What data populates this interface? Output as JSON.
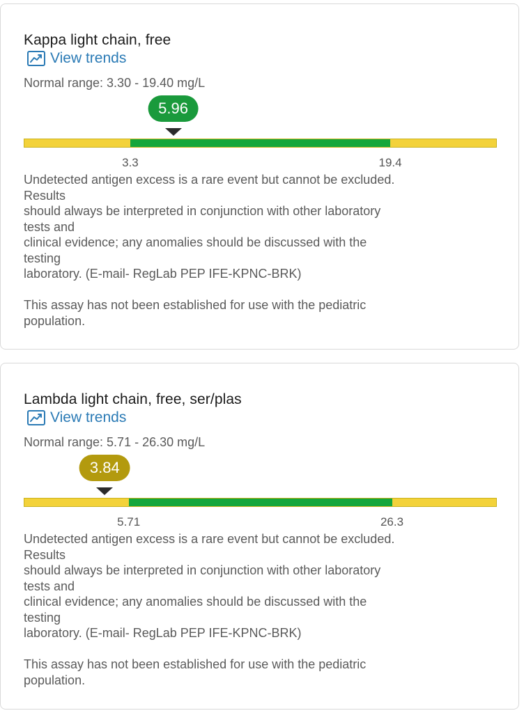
{
  "results": [
    {
      "title": "Kappa light chain, free",
      "trends_label": "View trends",
      "trends_icon": "trend-chart-icon",
      "normal_range": "Normal range: 3.30 - 19.40 mg/L",
      "value": "5.96",
      "value_color": "#1a9a3c",
      "low_label": "3.3",
      "high_label": "19.4",
      "scale": {
        "min": -3.3,
        "low": 3.3,
        "high": 19.4,
        "max": 26.0
      },
      "colors": {
        "out_of_range": "#f3d23a",
        "in_range": "#14a63c"
      },
      "comment_lines": [
        "Undetected antigen excess is a rare event but cannot be excluded.",
        "Results",
        "should always be interpreted in conjunction with other laboratory",
        "tests and",
        "clinical evidence; any anomalies should be discussed with the",
        "testing",
        "laboratory. (E-mail- RegLab PEP IFE-KPNC-BRK)"
      ],
      "pediatric_lines": [
        "This assay has not been established for use with the pediatric",
        "population."
      ]
    },
    {
      "title": "Lambda light chain, free, ser/plas",
      "trends_label": "View trends",
      "trends_icon": "trend-chart-icon",
      "normal_range": "Normal range: 5.71 - 26.30 mg/L",
      "value": "3.84",
      "value_color": "#b39a0e",
      "low_label": "5.71",
      "high_label": "26.3",
      "scale": {
        "min": -2.5,
        "low": 5.71,
        "high": 26.3,
        "max": 34.5
      },
      "colors": {
        "out_of_range": "#f3d23a",
        "in_range": "#14a63c"
      },
      "comment_lines": [
        "Undetected antigen excess is a rare event but cannot be excluded.",
        "Results",
        "should always be interpreted in conjunction with other laboratory",
        "tests and",
        "clinical evidence; any anomalies should be discussed with the",
        "testing",
        "laboratory. (E-mail- RegLab PEP IFE-KPNC-BRK)"
      ],
      "pediatric_lines": [
        "This assay has not been established for use with the pediatric",
        "population."
      ]
    }
  ]
}
